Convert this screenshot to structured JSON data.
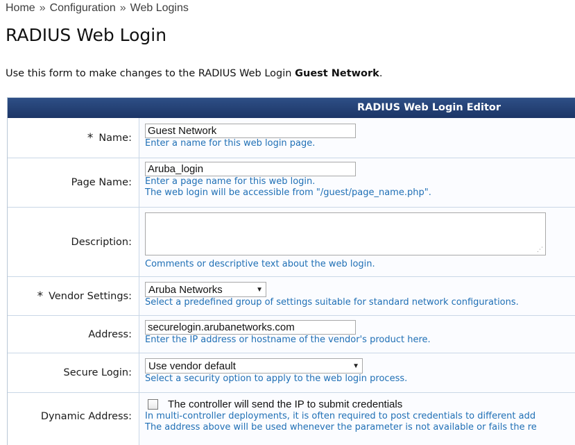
{
  "breadcrumb": {
    "items": [
      "Home",
      "Configuration",
      "Web Logins"
    ],
    "separator": "»"
  },
  "page": {
    "title": "RADIUS Web Login",
    "intro_prefix": "Use this form to make changes to the RADIUS Web Login ",
    "intro_bold": "Guest Network",
    "intro_suffix": "."
  },
  "editor": {
    "title": "RADIUS Web Login Editor",
    "colors": {
      "header_bg": "#1c3566",
      "hint_text": "#1f6fb5",
      "row_border": "#c9d7e6"
    },
    "fields": {
      "name": {
        "required_mark": "*",
        "label": "Name:",
        "value": "Guest Network",
        "hint": "Enter a name for this web login page."
      },
      "page_name": {
        "label": "Page Name:",
        "value": "Aruba_login",
        "hint1": "Enter a page name for this web login.",
        "hint2": "The web login will be accessible from \"/guest/page_name.php\"."
      },
      "description": {
        "label": "Description:",
        "value": "",
        "hint": "Comments or descriptive text about the web login."
      },
      "vendor_settings": {
        "required_mark": "*",
        "label": "Vendor Settings:",
        "value": "Aruba Networks",
        "hint": "Select a predefined group of settings suitable for standard network configurations."
      },
      "address": {
        "label": "Address:",
        "value": "securelogin.arubanetworks.com",
        "hint": "Enter the IP address or hostname of the vendor's product here."
      },
      "secure_login": {
        "label": "Secure Login:",
        "value": "Use vendor default",
        "hint": "Select a security option to apply to the web login process."
      },
      "dynamic_address": {
        "label": "Dynamic Address:",
        "checked": false,
        "checkbox_label": "The controller will send the IP to submit credentials",
        "hint1": "In multi-controller deployments, it is often required to post credentials to different add",
        "hint2": "The address above will be used whenever the parameter is not available or fails the re"
      }
    }
  }
}
